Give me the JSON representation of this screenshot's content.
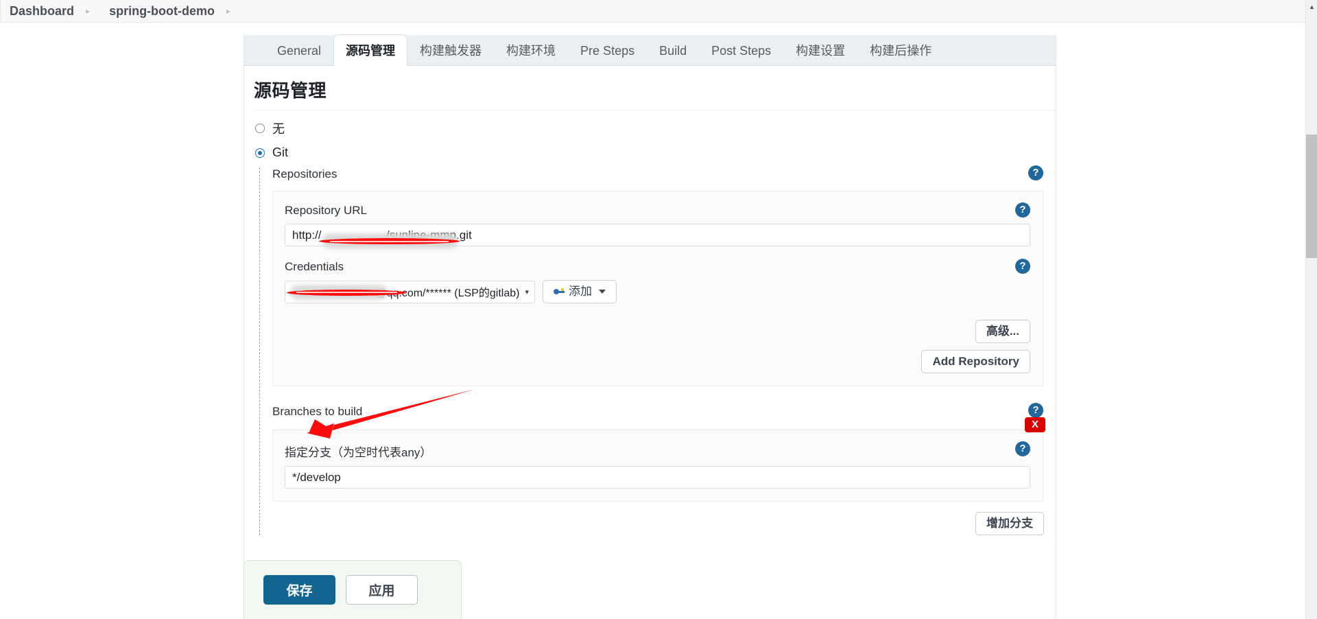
{
  "breadcrumb": {
    "items": [
      {
        "label": "Dashboard"
      },
      {
        "label": "spring-boot-demo"
      }
    ],
    "separator": "▸"
  },
  "tabs": [
    {
      "label": "General",
      "active": false
    },
    {
      "label": "源码管理",
      "active": true
    },
    {
      "label": "构建触发器",
      "active": false
    },
    {
      "label": "构建环境",
      "active": false
    },
    {
      "label": "Pre Steps",
      "active": false
    },
    {
      "label": "Build",
      "active": false
    },
    {
      "label": "Post Steps",
      "active": false
    },
    {
      "label": "构建设置",
      "active": false
    },
    {
      "label": "构建后操作",
      "active": false
    }
  ],
  "scm": {
    "heading": "源码管理",
    "options": [
      {
        "label": "无",
        "selected": false
      },
      {
        "label": "Git",
        "selected": true
      }
    ],
    "repositories_label": "Repositories",
    "repository": {
      "url_label": "Repository URL",
      "url_prefix": "http://",
      "url_suffix": "/sunline-mmp.git",
      "url_value": "http://████████/sunline-mmp.git",
      "url_placeholder": "",
      "credentials_label": "Credentials",
      "credentials_value": "@qq.com/****** (LSP的gitlab)",
      "add_credentials_label": "添加",
      "advanced_label": "高级...",
      "add_repository_label": "Add Repository"
    },
    "branches": {
      "section_label": "Branches to build",
      "branch_spec_label": "指定分支（为空时代表any）",
      "branch_spec_value": "*/develop",
      "branch_spec_placeholder": "",
      "add_branch_label": "增加分支",
      "delete_badge_label": "X"
    },
    "help_icon": "?"
  },
  "footer": {
    "save_label": "保存",
    "apply_label": "应用"
  },
  "scrollbar": {
    "up_arrow": "▲"
  },
  "colors": {
    "accent": "#11658f",
    "help": "#21679b",
    "radio": "#1f6fb5",
    "danger": "#d90000",
    "annotation": "#fc0d0d",
    "tab_strip": "#eaeff3"
  }
}
